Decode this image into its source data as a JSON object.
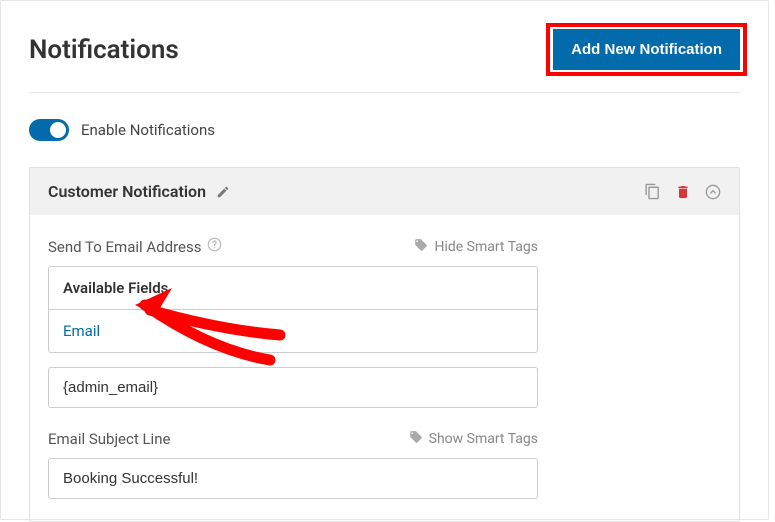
{
  "header": {
    "title": "Notifications",
    "add_button": "Add New Notification"
  },
  "toggle": {
    "label": "Enable Notifications"
  },
  "panel": {
    "title": "Customer Notification"
  },
  "field1": {
    "label": "Send To Email Address",
    "smart_tags_toggle": "Hide Smart Tags",
    "dropdown_header": "Available Fields",
    "dropdown_item": "Email",
    "input_value": "{admin_email}"
  },
  "field2": {
    "label": "Email Subject Line",
    "smart_tags_toggle": "Show Smart Tags",
    "input_value": "Booking Successful!"
  }
}
